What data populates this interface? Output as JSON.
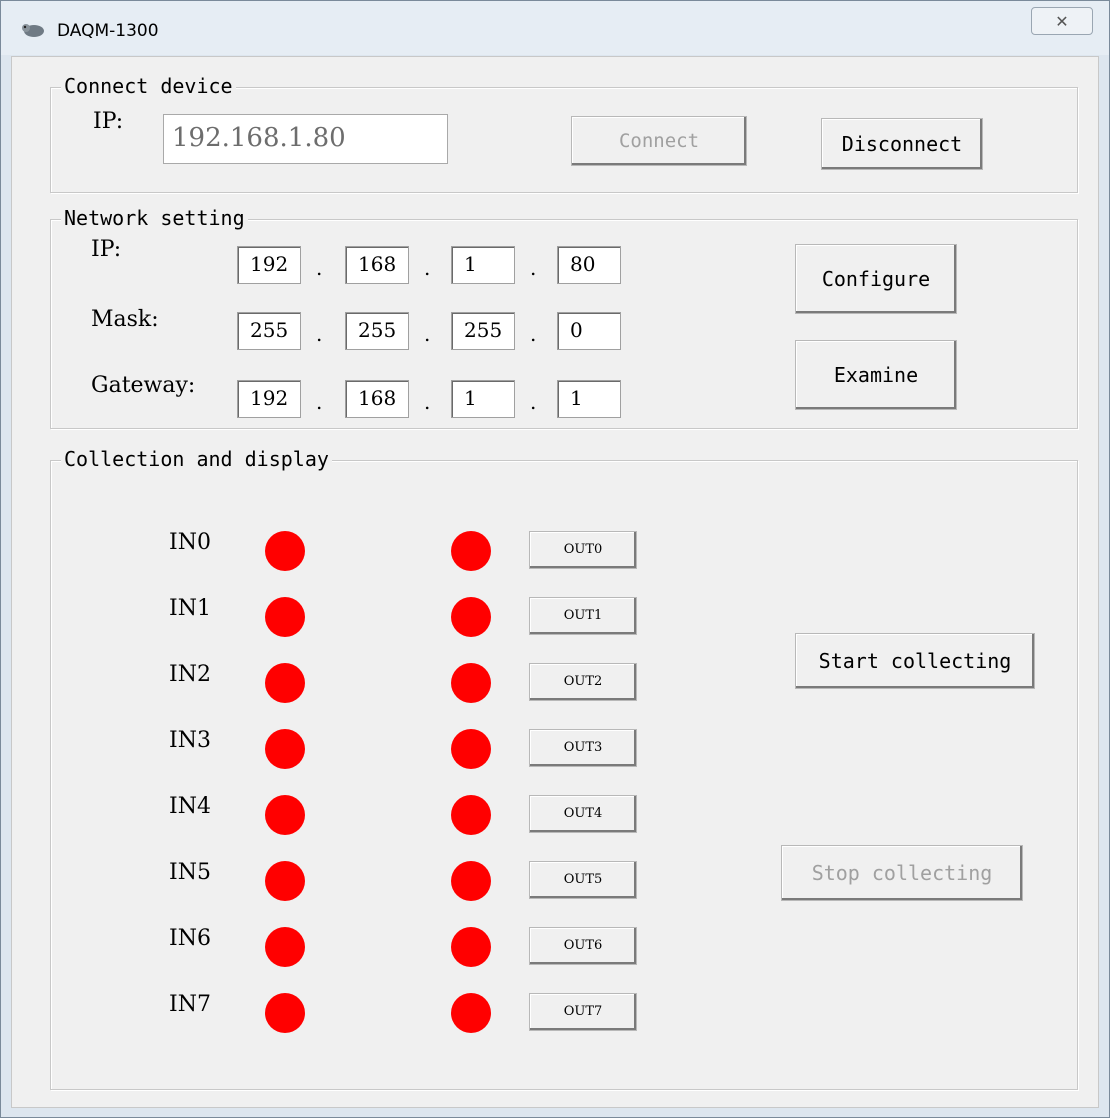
{
  "window": {
    "title": "DAQM-1300",
    "close_symbol": "✕",
    "icon": "app-icon"
  },
  "connect": {
    "group_title": "Connect device",
    "ip_label": "IP:",
    "ip_value": "192.168.1.80",
    "connect_label": "Connect",
    "disconnect_label": "Disconnect"
  },
  "network": {
    "group_title": "Network setting",
    "dot": ".",
    "rows": [
      {
        "label": "IP:",
        "octets": [
          "192",
          "168",
          "1",
          "80"
        ]
      },
      {
        "label": "Mask:",
        "octets": [
          "255",
          "255",
          "255",
          "0"
        ]
      },
      {
        "label": "Gateway:",
        "octets": [
          "192",
          "168",
          "1",
          "1"
        ]
      }
    ],
    "configure_label": "Configure",
    "examine_label": "Examine"
  },
  "collection": {
    "group_title": "Collection and display",
    "inputs": [
      "IN0",
      "IN1",
      "IN2",
      "IN3",
      "IN4",
      "IN5",
      "IN6",
      "IN7"
    ],
    "outputs": [
      "OUT0",
      "OUT1",
      "OUT2",
      "OUT3",
      "OUT4",
      "OUT5",
      "OUT6",
      "OUT7"
    ],
    "indicator_color": "#ff0000",
    "start_label": "Start collecting",
    "stop_label": "Stop collecting"
  }
}
